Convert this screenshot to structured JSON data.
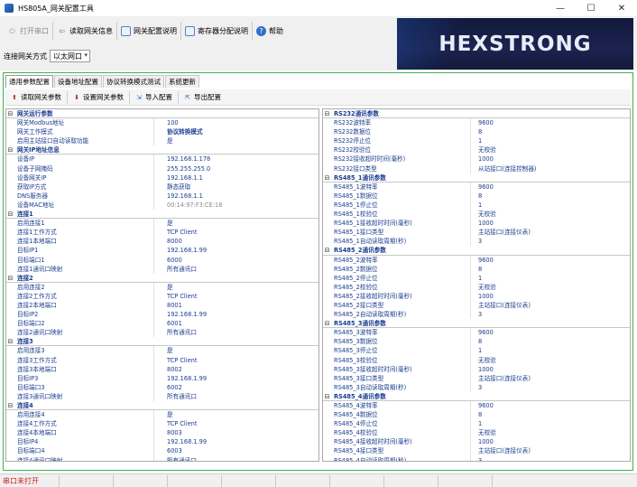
{
  "window": {
    "title": "HS805A_网关配置工具",
    "min": "—",
    "max": "☐",
    "close": "✕"
  },
  "toolbar": {
    "open_port": "打开串口",
    "read_info": "读取网关信息",
    "config_help": "网关配置说明",
    "register_help": "寄存器分配说明",
    "help": "帮助",
    "conn_label": "连接网关方式",
    "conn_value": "以太网口"
  },
  "logo": "HEXSTRONG",
  "tabs": [
    "通用参数配置",
    "设备地址配置",
    "协议转换模式测试",
    "系统更新"
  ],
  "actions": {
    "read": "读取网关参数",
    "set": "设置网关参数",
    "import": "导入配置",
    "export": "导出配置"
  },
  "left_rows": [
    {
      "type": "cat",
      "name": "网关运行参数"
    },
    {
      "name": "网关Modbus地址",
      "value": "100"
    },
    {
      "name": "网关工作模式",
      "value": "协议转换模式",
      "bold": true
    },
    {
      "name": "启用主站接口自动读取功能",
      "value": "是"
    },
    {
      "type": "cat",
      "name": "网关IP地址信息"
    },
    {
      "name": "设备IP",
      "value": "192.168.1.178"
    },
    {
      "name": "设备子网掩码",
      "value": "255.255.255.0"
    },
    {
      "name": "设备网关IP",
      "value": "192.168.1.1"
    },
    {
      "name": "获取IP方式",
      "value": "静态获取"
    },
    {
      "name": "DNS服务器",
      "value": "192.168.1.1"
    },
    {
      "name": "设备MAC地址",
      "value": "00:14:97:F3:CE:18",
      "grey": true
    },
    {
      "type": "cat",
      "name": "连接1"
    },
    {
      "name": "启用连接1",
      "value": "是"
    },
    {
      "name": "连接1工作方式",
      "value": "TCP Client"
    },
    {
      "name": "连接1本地端口",
      "value": "8000"
    },
    {
      "name": "目标IP1",
      "value": "192.168.1.99"
    },
    {
      "name": "目标端口1",
      "value": "6000"
    },
    {
      "name": "连接1通讯口映射",
      "value": "所有通讯口"
    },
    {
      "type": "cat",
      "name": "连接2"
    },
    {
      "name": "启用连接2",
      "value": "是"
    },
    {
      "name": "连接2工作方式",
      "value": "TCP Client"
    },
    {
      "name": "连接2本地端口",
      "value": "8001"
    },
    {
      "name": "目标IP2",
      "value": "192.168.1.99"
    },
    {
      "name": "目标端口2",
      "value": "6001"
    },
    {
      "name": "连接2通讯口映射",
      "value": "所有通讯口"
    },
    {
      "type": "cat",
      "name": "连接3"
    },
    {
      "name": "启用连接3",
      "value": "是"
    },
    {
      "name": "连接3工作方式",
      "value": "TCP Client"
    },
    {
      "name": "连接3本地端口",
      "value": "8002"
    },
    {
      "name": "目标IP3",
      "value": "192.168.1.99"
    },
    {
      "name": "目标端口3",
      "value": "6002"
    },
    {
      "name": "连接3通讯口映射",
      "value": "所有通讯口"
    },
    {
      "type": "cat",
      "name": "连接4"
    },
    {
      "name": "启用连接4",
      "value": "是"
    },
    {
      "name": "连接4工作方式",
      "value": "TCP Client"
    },
    {
      "name": "连接4本地端口",
      "value": "8003"
    },
    {
      "name": "目标IP4",
      "value": "192.168.1.99"
    },
    {
      "name": "目标端口4",
      "value": "6003"
    },
    {
      "name": "连接4通讯口映射",
      "value": "所有通讯口"
    }
  ],
  "right_rows": [
    {
      "type": "cat",
      "name": "RS232通讯参数"
    },
    {
      "name": "RS232波特率",
      "value": "9600"
    },
    {
      "name": "RS232数据位",
      "value": "8"
    },
    {
      "name": "RS232停止位",
      "value": "1"
    },
    {
      "name": "RS232校验位",
      "value": "无校验"
    },
    {
      "name": "RS232接收超时时间(毫秒)",
      "value": "1000"
    },
    {
      "name": "RS232接口类型",
      "value": "从站接口(连接控制器)"
    },
    {
      "type": "cat",
      "name": "RS485_1通讯参数"
    },
    {
      "name": "RS485_1波特率",
      "value": "9600"
    },
    {
      "name": "RS485_1数据位",
      "value": "8"
    },
    {
      "name": "RS485_1停止位",
      "value": "1"
    },
    {
      "name": "RS485_1校验位",
      "value": "无校验"
    },
    {
      "name": "RS485_1接收超时时间(毫秒)",
      "value": "1000"
    },
    {
      "name": "RS485_1接口类型",
      "value": "主站接口(连接仪表)"
    },
    {
      "name": "RS485_1自动读取周期(秒)",
      "value": "3"
    },
    {
      "type": "cat",
      "name": "RS485_2通讯参数"
    },
    {
      "name": "RS485_2波特率",
      "value": "9600"
    },
    {
      "name": "RS485_2数据位",
      "value": "8"
    },
    {
      "name": "RS485_2停止位",
      "value": "1"
    },
    {
      "name": "RS485_2校验位",
      "value": "无校验"
    },
    {
      "name": "RS485_2接收超时时间(毫秒)",
      "value": "1000"
    },
    {
      "name": "RS485_2接口类型",
      "value": "主站接口(连接仪表)"
    },
    {
      "name": "RS485_2自动读取周期(秒)",
      "value": "3"
    },
    {
      "type": "cat",
      "name": "RS485_3通讯参数"
    },
    {
      "name": "RS485_3波特率",
      "value": "9600"
    },
    {
      "name": "RS485_3数据位",
      "value": "8"
    },
    {
      "name": "RS485_3停止位",
      "value": "1"
    },
    {
      "name": "RS485_3校验位",
      "value": "无校验"
    },
    {
      "name": "RS485_3接收超时时间(毫秒)",
      "value": "1000"
    },
    {
      "name": "RS485_3接口类型",
      "value": "主站接口(连接仪表)"
    },
    {
      "name": "RS485_3自动读取周期(秒)",
      "value": "3"
    },
    {
      "type": "cat",
      "name": "RS485_4通讯参数"
    },
    {
      "name": "RS485_4波特率",
      "value": "9600"
    },
    {
      "name": "RS485_4数据位",
      "value": "8"
    },
    {
      "name": "RS485_4停止位",
      "value": "1"
    },
    {
      "name": "RS485_4校验位",
      "value": "无校验"
    },
    {
      "name": "RS485_4接收超时时间(毫秒)",
      "value": "1000"
    },
    {
      "name": "RS485_4接口类型",
      "value": "主站接口(连接仪表)"
    },
    {
      "name": "RS485_4自动读取周期(秒)",
      "value": "3"
    }
  ],
  "status": {
    "text": "串口未打开"
  }
}
